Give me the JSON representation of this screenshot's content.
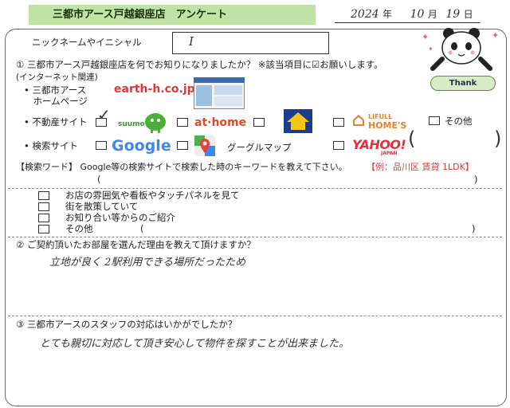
{
  "header": {
    "title": "三都市アース戸越銀座店　アンケート"
  },
  "date": {
    "year": "2024",
    "year_unit": "年",
    "month": "10",
    "month_unit": "月",
    "day": "19",
    "day_unit": "日"
  },
  "nickname": {
    "label": "ニックネームやイニシャル",
    "value": "I"
  },
  "q1": {
    "text": "① 三都市アース戸越銀座店を何でお知りになりましたか？ ※該当項目に☑お願いします。",
    "internet_label": "(インターネット関連)",
    "homepage_label_1": "• 三都市アース",
    "homepage_label_2": "　ホームページ",
    "homepage_url": "earth-h.co.jp",
    "realestate_label": "• 不動産サイト",
    "realestate_check": "✓",
    "suumo": "suumo",
    "athome": "at·home",
    "lifull_1": "LIFULL",
    "lifull_2": "HOME'S",
    "other_label": "その他",
    "other_paren_open": "(",
    "other_paren_close": ")",
    "search_label": "• 検索サイト",
    "google": "Google",
    "googlemap": "グーグルマップ",
    "yahoo": "YAHOO!",
    "yahoo_sub": "JAPAN",
    "keyword_label": "【検索ワード】 Google等の検索サイトで検索した時のキーワードを教えて下さい。",
    "keyword_example": "【例：品川区 賃貸 1LDK】",
    "keyword_paren_open": "(",
    "keyword_paren_close": ")",
    "offline_1": "お店の雰囲気や看板やタッチパネルを見て",
    "offline_2": "街を散策していて",
    "offline_3": "お知り合い等からのご紹介",
    "offline_4": "その他",
    "offline_paren_open": "(",
    "offline_paren_close": ")"
  },
  "q2": {
    "text": "② ご契約頂いたお部屋を選んだ理由を教えて頂けますか？",
    "answer": "立地が良く 2駅利用できる場所だったため"
  },
  "q3": {
    "text": "③ 三都市アースのスタッフの対応はいかがでしたか？",
    "answer": "とても親切に対応して頂き安心して物件を探すことが出来ました。"
  },
  "mascot": {
    "thank": "Thank"
  },
  "colors": {
    "header_bg": "#bfe3a4",
    "accent_red": "#d43b2f"
  }
}
